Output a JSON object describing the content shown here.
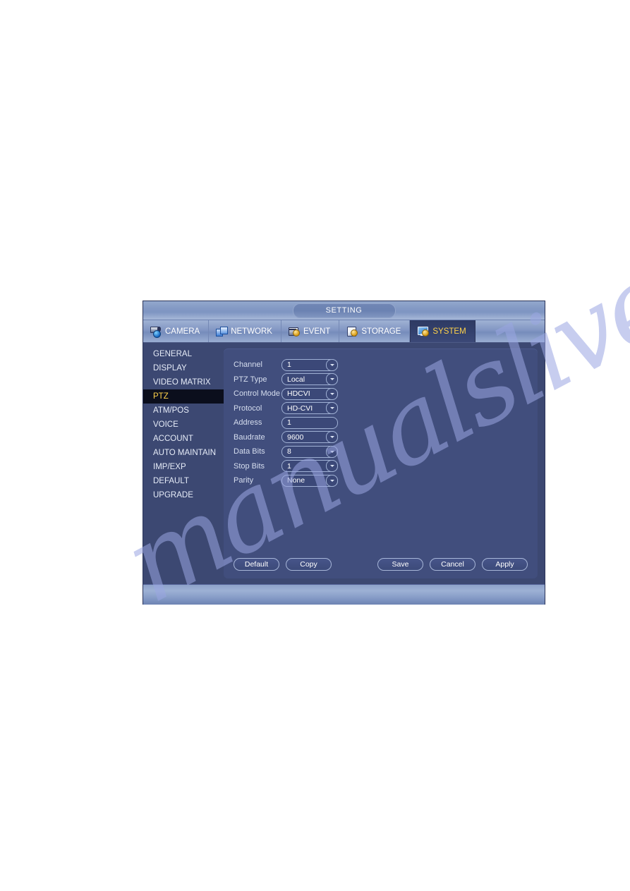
{
  "watermark": {
    "text": "manualslive.com"
  },
  "window": {
    "title": "SETTING",
    "tabs": [
      {
        "label": "CAMERA",
        "icon": "camera-icon",
        "active": false
      },
      {
        "label": "NETWORK",
        "icon": "network-icon",
        "active": false
      },
      {
        "label": "EVENT",
        "icon": "event-icon",
        "active": false
      },
      {
        "label": "STORAGE",
        "icon": "storage-icon",
        "active": false
      },
      {
        "label": "SYSTEM",
        "icon": "system-icon",
        "active": true
      }
    ],
    "sidebar": {
      "items": [
        {
          "label": "GENERAL",
          "active": false
        },
        {
          "label": "DISPLAY",
          "active": false
        },
        {
          "label": "VIDEO MATRIX",
          "active": false
        },
        {
          "label": "PTZ",
          "active": true
        },
        {
          "label": "ATM/POS",
          "active": false
        },
        {
          "label": "VOICE",
          "active": false
        },
        {
          "label": "ACCOUNT",
          "active": false
        },
        {
          "label": "AUTO MAINTAIN",
          "active": false
        },
        {
          "label": "IMP/EXP",
          "active": false
        },
        {
          "label": "DEFAULT",
          "active": false
        },
        {
          "label": "UPGRADE",
          "active": false
        }
      ]
    },
    "form": {
      "rows": [
        {
          "label": "Channel",
          "value": "1",
          "type": "dropdown"
        },
        {
          "label": "PTZ Type",
          "value": "Local",
          "type": "dropdown"
        },
        {
          "label": "Control Mode",
          "value": "HDCVI",
          "type": "dropdown"
        },
        {
          "label": "Protocol",
          "value": "HD-CVI",
          "type": "dropdown"
        },
        {
          "label": "Address",
          "value": "1",
          "type": "input"
        },
        {
          "label": "Baudrate",
          "value": "9600",
          "type": "dropdown"
        },
        {
          "label": "Data Bits",
          "value": "8",
          "type": "dropdown"
        },
        {
          "label": "Stop Bits",
          "value": "1",
          "type": "dropdown"
        },
        {
          "label": "Parity",
          "value": "None",
          "type": "dropdown"
        }
      ]
    },
    "buttons": {
      "left": [
        {
          "label": "Default"
        },
        {
          "label": "Copy"
        }
      ],
      "right": [
        {
          "label": "Save"
        },
        {
          "label": "Cancel"
        },
        {
          "label": "Apply"
        }
      ]
    }
  },
  "colors": {
    "window_bg": "#3c4872",
    "panel_bg": "#414e7d",
    "accent_gold": "#ffd24a",
    "active_item_bg": "#0b0e1c",
    "titlebar_blue": "#8399c4"
  }
}
